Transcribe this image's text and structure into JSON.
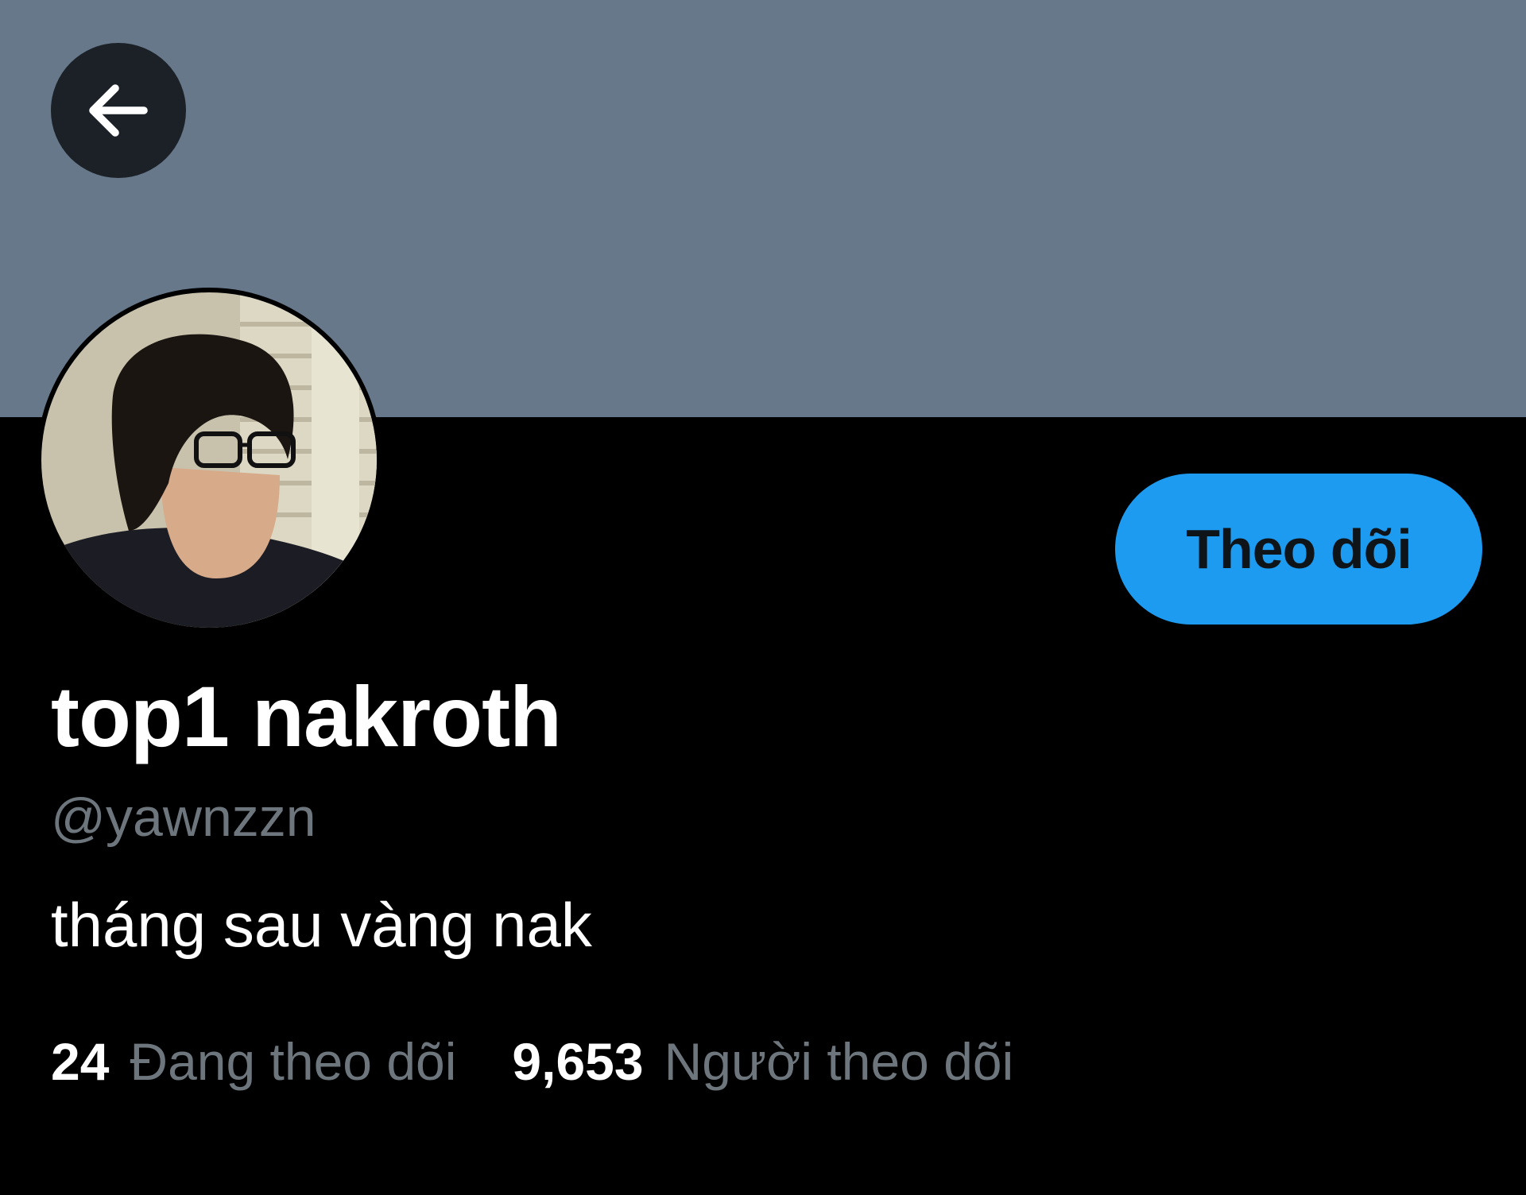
{
  "header": {
    "back_icon": "arrow-left-icon",
    "banner_color": "#66788a"
  },
  "profile": {
    "follow_label": "Theo dõi",
    "follow_color": "#1d9bf0",
    "display_name": "top1 nakroth",
    "handle": "@yawnzzn",
    "bio": "tháng sau vàng nak"
  },
  "stats": {
    "following_count": "24",
    "following_label": "Đang theo dõi",
    "followers_count": "9,653",
    "followers_label": "Người theo dõi"
  }
}
